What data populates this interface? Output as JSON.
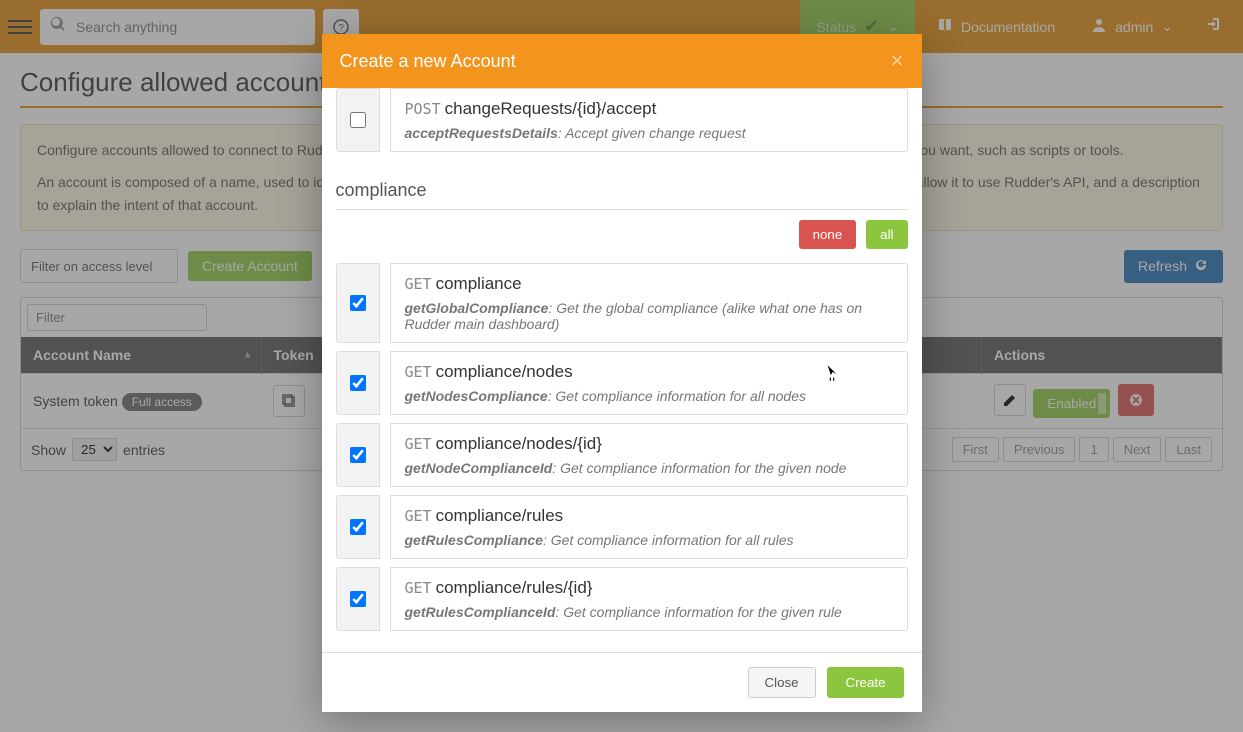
{
  "topbar": {
    "search_placeholder": "Search anything",
    "status_label": "Status",
    "documentation_label": "Documentation",
    "user_label": "admin"
  },
  "page": {
    "title": "Configure allowed accounts",
    "info_line1": "Configure accounts allowed to connect to Rudder's REST API. An API account is not linked to a specific user, and can be used in any context you want, such as scripts or tools.",
    "info_line2": "An account is composed of a name, used to identify its action (for example in event logs), an authentication token, which is the secret that will allow it to use Rudder's API, and a description to explain the intent of that account.",
    "filter_level_label": "Filter on access level",
    "create_account_label": "Create Account",
    "refresh_label": "Refresh",
    "table_filter_placeholder": "Filter",
    "columns": {
      "name": "Account Name",
      "token": "Token",
      "actions": "Actions"
    },
    "rows": [
      {
        "name": "System token",
        "badge": "Full access",
        "enabled_label": "Enabled"
      }
    ],
    "show_label": "Show",
    "entries_value": "25",
    "entries_label": "entries",
    "pager": {
      "first": "First",
      "prev": "Previous",
      "page": "1",
      "next": "Next",
      "last": "Last"
    }
  },
  "modal": {
    "title": "Create a new Account",
    "section_compliance": "compliance",
    "btn_none": "none",
    "btn_all": "all",
    "btn_close": "Close",
    "btn_create": "Create",
    "apis": [
      {
        "checked": false,
        "method": "POST",
        "path": "changeRequests/{id}/accept",
        "op": "acceptRequestsDetails",
        "desc": "Accept given change request"
      },
      {
        "checked": true,
        "method": "GET",
        "path": "compliance",
        "op": "getGlobalCompliance",
        "desc": "Get the global compliance (alike what one has on Rudder main dashboard)"
      },
      {
        "checked": true,
        "method": "GET",
        "path": "compliance/nodes",
        "op": "getNodesCompliance",
        "desc": "Get compliance information for all nodes"
      },
      {
        "checked": true,
        "method": "GET",
        "path": "compliance/nodes/{id}",
        "op": "getNodeComplianceId",
        "desc": "Get compliance information for the given node"
      },
      {
        "checked": true,
        "method": "GET",
        "path": "compliance/rules",
        "op": "getRulesCompliance",
        "desc": "Get compliance information for all rules"
      },
      {
        "checked": true,
        "method": "GET",
        "path": "compliance/rules/{id}",
        "op": "getRulesComplianceId",
        "desc": "Get compliance information for the given rule"
      }
    ]
  }
}
